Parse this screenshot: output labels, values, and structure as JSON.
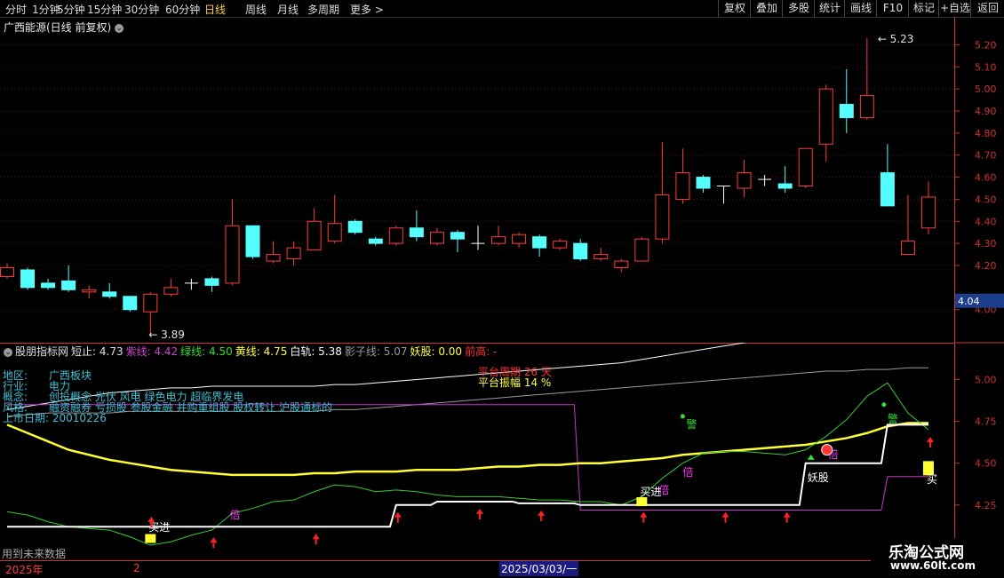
{
  "toolbar": {
    "left_items": [
      "分时",
      "1分钟",
      "5分钟",
      "15分钟",
      "30分钟",
      "60分钟",
      "日线",
      "周线",
      "月线",
      "多周期",
      "更多 >"
    ],
    "active_index": 6,
    "right_items": [
      "复权",
      "叠加",
      "多股",
      "统计",
      "画线",
      "F10",
      "标记",
      "+自选",
      "返回"
    ]
  },
  "stock": {
    "title": "广西能源(日线 前复权)",
    "dropdown_icon": "chevron-down-icon",
    "high_label": "5.23",
    "low_label": "3.89",
    "current_price": "4.04"
  },
  "colors": {
    "up": "#ff3b3b",
    "down": "#54ffff",
    "yellow": "#ffff33",
    "white": "#ffffff",
    "purple": "#cc33cc",
    "green": "#33cc33",
    "gray": "#9a9a9a",
    "cyan_text": "#3fbfd6",
    "axis": "#d03030"
  },
  "price_axis": {
    "ticks": [
      "5.20",
      "5.10",
      "5.00",
      "4.90",
      "4.80",
      "4.70",
      "4.60",
      "4.50",
      "4.40",
      "4.30",
      "4.20",
      "4.00"
    ]
  },
  "indicator": {
    "name": "股朋指标网",
    "items": [
      {
        "label": "短止:",
        "value": "4.73",
        "color": "#e0e0e0"
      },
      {
        "label": "紫线:",
        "value": "4.42",
        "color": "#cc44cc"
      },
      {
        "label": "绿线:",
        "value": "4.50",
        "color": "#33dd33"
      },
      {
        "label": "黄线:",
        "value": "4.75",
        "color": "#ffff44"
      },
      {
        "label": "白轨:",
        "value": "5.38",
        "color": "#ffffff"
      },
      {
        "label": "影子线:",
        "value": "5.07",
        "color": "#999999"
      },
      {
        "label": "妖股:",
        "value": "0.00",
        "color": "#ffff44"
      },
      {
        "label": "前高:",
        "value": "-",
        "color": "#ff3333"
      }
    ],
    "axis_ticks": [
      "5.00",
      "4.75",
      "4.50",
      "4.25",
      "4.00"
    ]
  },
  "info": {
    "region_k": "地区:",
    "region_v": "广西板块",
    "industry_k": "行业:",
    "industry_v": "电力",
    "concept_k": "概念:",
    "concept_v": "创投概念 光伏 风电 绿色电力 超临界发电",
    "style_k": "风格:",
    "style_v": "融资融券 亏损股 参股金融 并购重组股 股权转让 沪股通标的",
    "listing": "上市日期: 20010226"
  },
  "platform": {
    "period": "平台周期 26 天",
    "amplitude": "平台振幅 14 %"
  },
  "signals": {
    "buy": "买进",
    "double": "倍",
    "warn": "警",
    "monster": "妖股",
    "buy_short": "买"
  },
  "footer": {
    "future_note": "用到未来数据",
    "year": "2025年",
    "month": "2",
    "date": "2025/03/03/一"
  },
  "watermark": {
    "line1": "乐淘公式网",
    "line2": "www.60lt.com"
  },
  "chart_data": {
    "type": "candlestick",
    "candles": [
      {
        "o": 4.15,
        "c": 4.19,
        "h": 4.21,
        "l": 4.14
      },
      {
        "o": 4.18,
        "c": 4.1,
        "h": 4.19,
        "l": 4.09
      },
      {
        "o": 4.12,
        "c": 4.1,
        "h": 4.14,
        "l": 4.09
      },
      {
        "o": 4.13,
        "c": 4.09,
        "h": 4.2,
        "l": 4.08
      },
      {
        "o": 4.08,
        "c": 4.09,
        "h": 4.11,
        "l": 4.05
      },
      {
        "o": 4.08,
        "c": 4.06,
        "h": 4.12,
        "l": 4.05
      },
      {
        "o": 4.06,
        "c": 4.0,
        "h": 4.06,
        "l": 3.99
      },
      {
        "o": 3.99,
        "c": 4.07,
        "h": 4.08,
        "l": 3.89
      },
      {
        "o": 4.07,
        "c": 4.1,
        "h": 4.14,
        "l": 4.06
      },
      {
        "o": 4.12,
        "c": 4.12,
        "h": 4.14,
        "l": 4.09
      },
      {
        "o": 4.14,
        "c": 4.11,
        "h": 4.15,
        "l": 4.08
      },
      {
        "o": 4.12,
        "c": 4.38,
        "h": 4.5,
        "l": 4.11
      },
      {
        "o": 4.38,
        "c": 4.24,
        "h": 4.38,
        "l": 4.23
      },
      {
        "o": 4.22,
        "c": 4.25,
        "h": 4.31,
        "l": 4.21
      },
      {
        "o": 4.23,
        "c": 4.28,
        "h": 4.31,
        "l": 4.2
      },
      {
        "o": 4.27,
        "c": 4.4,
        "h": 4.46,
        "l": 4.27
      },
      {
        "o": 4.31,
        "c": 4.39,
        "h": 4.52,
        "l": 4.3
      },
      {
        "o": 4.4,
        "c": 4.35,
        "h": 4.41,
        "l": 4.34
      },
      {
        "o": 4.32,
        "c": 4.3,
        "h": 4.33,
        "l": 4.29
      },
      {
        "o": 4.3,
        "c": 4.37,
        "h": 4.38,
        "l": 4.29
      },
      {
        "o": 4.37,
        "c": 4.33,
        "h": 4.45,
        "l": 4.31
      },
      {
        "o": 4.3,
        "c": 4.35,
        "h": 4.37,
        "l": 4.29
      },
      {
        "o": 4.35,
        "c": 4.32,
        "h": 4.36,
        "l": 4.26
      },
      {
        "o": 4.3,
        "c": 4.3,
        "h": 4.38,
        "l": 4.27
      },
      {
        "o": 4.3,
        "c": 4.33,
        "h": 4.38,
        "l": 4.29
      },
      {
        "o": 4.3,
        "c": 4.34,
        "h": 4.35,
        "l": 4.28
      },
      {
        "o": 4.33,
        "c": 4.28,
        "h": 4.34,
        "l": 4.24
      },
      {
        "o": 4.28,
        "c": 4.31,
        "h": 4.32,
        "l": 4.27
      },
      {
        "o": 4.3,
        "c": 4.23,
        "h": 4.32,
        "l": 4.22
      },
      {
        "o": 4.23,
        "c": 4.25,
        "h": 4.28,
        "l": 4.22
      },
      {
        "o": 4.19,
        "c": 4.22,
        "h": 4.23,
        "l": 4.17
      },
      {
        "o": 4.22,
        "c": 4.32,
        "h": 4.33,
        "l": 4.22
      },
      {
        "o": 4.32,
        "c": 4.52,
        "h": 4.76,
        "l": 4.3
      },
      {
        "o": 4.5,
        "c": 4.62,
        "h": 4.73,
        "l": 4.48
      },
      {
        "o": 4.6,
        "c": 4.55,
        "h": 4.61,
        "l": 4.53
      },
      {
        "o": 4.56,
        "c": 4.56,
        "h": 4.56,
        "l": 4.48
      },
      {
        "o": 4.55,
        "c": 4.62,
        "h": 4.68,
        "l": 4.51
      },
      {
        "o": 4.59,
        "c": 4.59,
        "h": 4.61,
        "l": 4.56
      },
      {
        "o": 4.57,
        "c": 4.55,
        "h": 4.65,
        "l": 4.53
      },
      {
        "o": 4.56,
        "c": 4.73,
        "h": 4.73,
        "l": 4.55
      },
      {
        "o": 4.75,
        "c": 5.0,
        "h": 5.02,
        "l": 4.67
      },
      {
        "o": 4.93,
        "c": 4.87,
        "h": 5.09,
        "l": 4.8
      },
      {
        "o": 4.87,
        "c": 4.97,
        "h": 5.23,
        "l": 4.86
      },
      {
        "o": 4.62,
        "c": 4.47,
        "h": 4.75,
        "l": 4.47
      },
      {
        "o": 4.25,
        "c": 4.31,
        "h": 4.52,
        "l": 4.25
      },
      {
        "o": 4.37,
        "c": 4.51,
        "h": 4.58,
        "l": 4.34
      }
    ],
    "price_range": [
      3.85,
      5.25
    ],
    "indicator_range": [
      3.92,
      5.22
    ],
    "white_band": [
      4.12,
      4.12,
      4.12,
      4.12,
      4.12,
      4.12,
      4.12,
      4.12,
      4.12,
      4.12,
      4.12,
      4.12,
      4.12,
      4.12,
      4.12,
      4.12,
      4.12,
      4.12,
      4.12,
      4.25,
      4.25,
      4.27,
      4.27,
      4.27,
      4.27,
      4.26,
      4.26,
      4.26,
      4.25,
      4.25,
      4.25,
      4.25,
      4.25,
      4.25,
      4.25,
      4.25,
      4.25,
      4.25,
      4.25,
      4.5,
      4.5,
      4.5,
      4.5,
      4.73,
      4.73,
      4.73
    ],
    "purple_line": [
      4.85,
      4.85,
      4.85,
      4.85,
      4.85,
      4.85,
      4.85,
      4.85,
      4.85,
      4.85,
      4.85,
      4.85,
      4.85,
      4.85,
      4.85,
      4.85,
      4.85,
      4.85,
      4.85,
      4.85,
      4.85,
      4.85,
      4.85,
      4.85,
      4.85,
      4.85,
      4.85,
      4.85,
      4.22,
      4.22,
      4.22,
      4.22,
      4.22,
      4.22,
      4.22,
      4.22,
      4.22,
      4.22,
      4.22,
      4.22,
      4.22,
      4.22,
      4.22,
      4.42,
      4.42,
      4.42
    ],
    "yellow_line": [
      4.73,
      4.68,
      4.63,
      4.58,
      4.55,
      4.52,
      4.5,
      4.48,
      4.46,
      4.45,
      4.44,
      4.43,
      4.43,
      4.43,
      4.43,
      4.44,
      4.44,
      4.45,
      4.45,
      4.45,
      4.46,
      4.46,
      4.46,
      4.47,
      4.48,
      4.48,
      4.49,
      4.49,
      4.5,
      4.5,
      4.51,
      4.52,
      4.53,
      4.55,
      4.56,
      4.57,
      4.58,
      4.59,
      4.6,
      4.61,
      4.63,
      4.65,
      4.68,
      4.72,
      4.74,
      4.74
    ],
    "green_line": [
      4.21,
      4.19,
      4.15,
      4.12,
      4.11,
      4.1,
      4.06,
      4.01,
      4.03,
      4.07,
      4.1,
      4.2,
      4.23,
      4.27,
      4.28,
      4.33,
      4.37,
      4.36,
      4.33,
      4.34,
      4.33,
      4.31,
      4.3,
      4.3,
      4.3,
      4.29,
      4.28,
      4.28,
      4.27,
      4.27,
      4.25,
      4.3,
      4.41,
      4.5,
      4.56,
      4.57,
      4.57,
      4.56,
      4.55,
      4.58,
      4.66,
      4.76,
      4.9,
      4.98,
      4.8,
      4.7
    ],
    "white_upper": [
      4.82,
      4.84,
      4.86,
      4.88,
      4.9,
      4.92,
      4.93,
      4.94,
      4.95,
      4.95,
      4.96,
      4.96,
      4.96,
      4.96,
      4.96,
      4.96,
      4.97,
      4.97,
      4.98,
      4.99,
      5.0,
      5.01,
      5.02,
      5.03,
      5.04,
      5.05,
      5.06,
      5.07,
      5.08,
      5.09,
      5.1,
      5.12,
      5.14,
      5.16,
      5.18,
      5.2,
      5.22,
      5.24,
      5.26,
      5.28,
      5.3,
      5.32,
      5.34,
      5.36,
      5.37,
      5.38
    ],
    "gray_shadow": [
      4.78,
      4.79,
      4.8,
      4.8,
      4.8,
      4.8,
      4.81,
      4.81,
      4.81,
      4.81,
      4.81,
      4.81,
      4.81,
      4.81,
      4.81,
      4.81,
      4.82,
      4.82,
      4.83,
      4.84,
      4.85,
      4.86,
      4.87,
      4.88,
      4.89,
      4.9,
      4.91,
      4.92,
      4.93,
      4.94,
      4.95,
      4.96,
      4.97,
      4.98,
      4.99,
      5.0,
      5.01,
      5.02,
      5.03,
      5.04,
      5.05,
      5.05,
      5.06,
      5.06,
      5.07,
      5.07
    ]
  }
}
